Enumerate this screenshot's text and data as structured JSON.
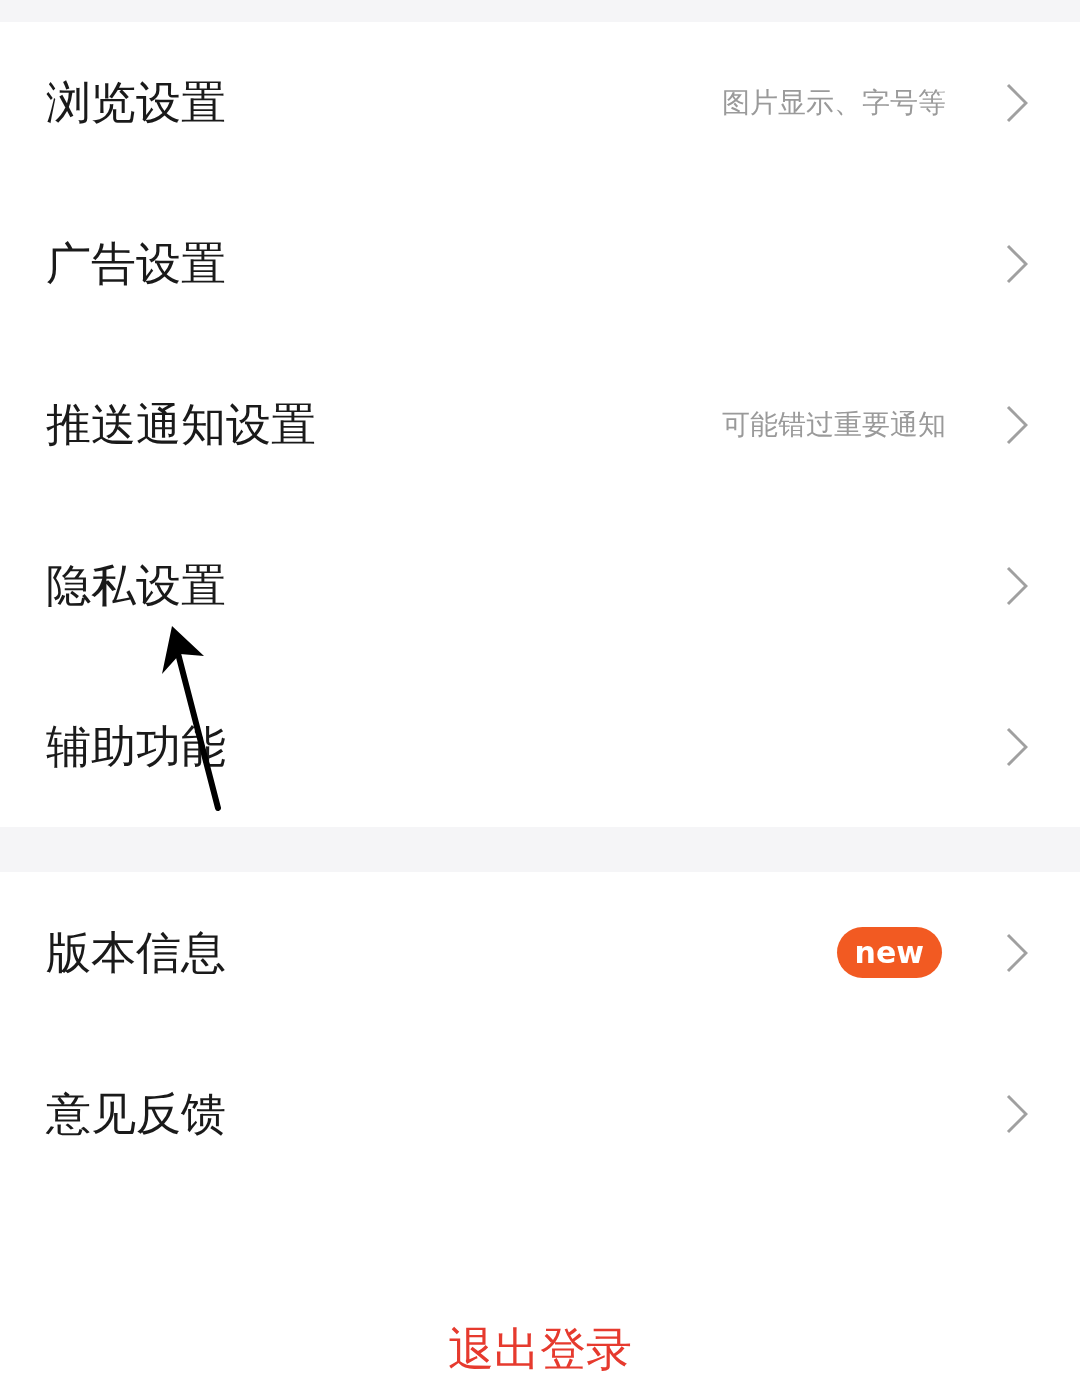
{
  "sections": [
    {
      "items": [
        {
          "title": "浏览设置",
          "subtitle": "图片显示、字号等"
        },
        {
          "title": "广告设置"
        },
        {
          "title": "推送通知设置",
          "subtitle": "可能错过重要通知"
        },
        {
          "title": "隐私设置"
        },
        {
          "title": "辅助功能"
        }
      ]
    },
    {
      "items": [
        {
          "title": "版本信息",
          "badge": "new"
        },
        {
          "title": "意见反馈"
        }
      ]
    }
  ],
  "logout_button": "退出登录"
}
